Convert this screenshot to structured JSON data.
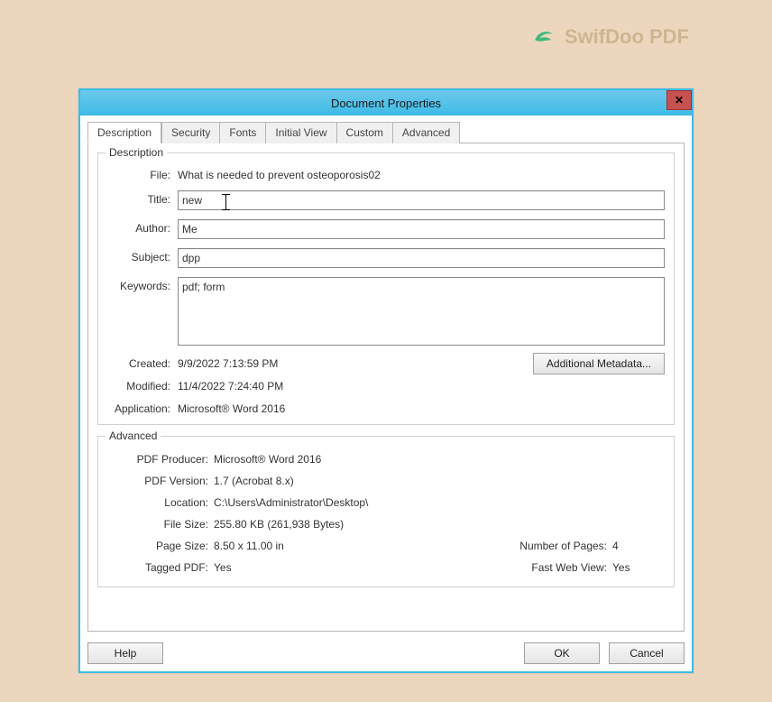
{
  "watermark": {
    "text": "SwifDoo PDF"
  },
  "dialog": {
    "title": "Document Properties",
    "close": "✕",
    "tabs": {
      "description": "Description",
      "security": "Security",
      "fonts": "Fonts",
      "initial_view": "Initial View",
      "custom": "Custom",
      "advanced": "Advanced"
    },
    "groups": {
      "description_legend": "Description",
      "advanced_legend": "Advanced"
    },
    "labels": {
      "file": "File:",
      "title": "Title:",
      "author": "Author:",
      "subject": "Subject:",
      "keywords": "Keywords:",
      "created": "Created:",
      "modified": "Modified:",
      "application": "Application:",
      "pdf_producer": "PDF Producer:",
      "pdf_version": "PDF Version:",
      "location": "Location:",
      "file_size": "File Size:",
      "page_size": "Page Size:",
      "num_pages": "Number of Pages:",
      "tagged_pdf": "Tagged PDF:",
      "fast_web": "Fast Web View:"
    },
    "values": {
      "file": "What is needed to prevent osteoporosis02",
      "title": "new",
      "author": "Me",
      "subject": "dpp",
      "keywords": "pdf; form",
      "created": "9/9/2022 7:13:59 PM",
      "modified": "11/4/2022 7:24:40 PM",
      "application": "Microsoft® Word 2016",
      "pdf_producer": "Microsoft® Word 2016",
      "pdf_version": "1.7 (Acrobat 8.x)",
      "location": "C:\\Users\\Administrator\\Desktop\\",
      "file_size": "255.80 KB (261,938 Bytes)",
      "page_size": "8.50 x 11.00 in",
      "num_pages": "4",
      "tagged_pdf": "Yes",
      "fast_web": "Yes"
    },
    "buttons": {
      "additional_metadata": "Additional Metadata...",
      "help": "Help",
      "ok": "OK",
      "cancel": "Cancel"
    }
  }
}
